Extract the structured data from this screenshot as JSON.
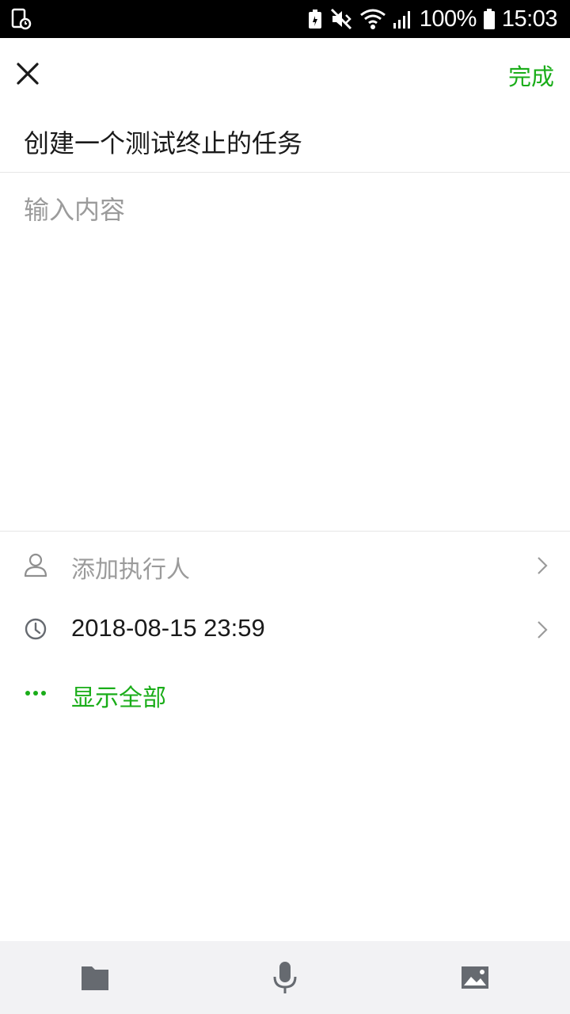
{
  "status_bar": {
    "battery_text": "100%",
    "time": "15:03"
  },
  "header": {
    "close_icon": "close-icon",
    "done_label": "完成"
  },
  "task": {
    "title": "创建一个测试终止的任务",
    "content_placeholder": "输入内容",
    "content_value": ""
  },
  "options": {
    "assignee_label": "添加执行人",
    "deadline_value": "2018-08-15 23:59",
    "show_all_label": "显示全部"
  },
  "toolbar": {
    "icons": [
      "folder-icon",
      "microphone-icon",
      "image-icon"
    ]
  },
  "colors": {
    "accent": "#1aad19",
    "text": "#1a1a1a",
    "secondary": "#9b9b9b",
    "toolbar_bg": "#f2f2f4",
    "icon_gray": "#666a70"
  }
}
